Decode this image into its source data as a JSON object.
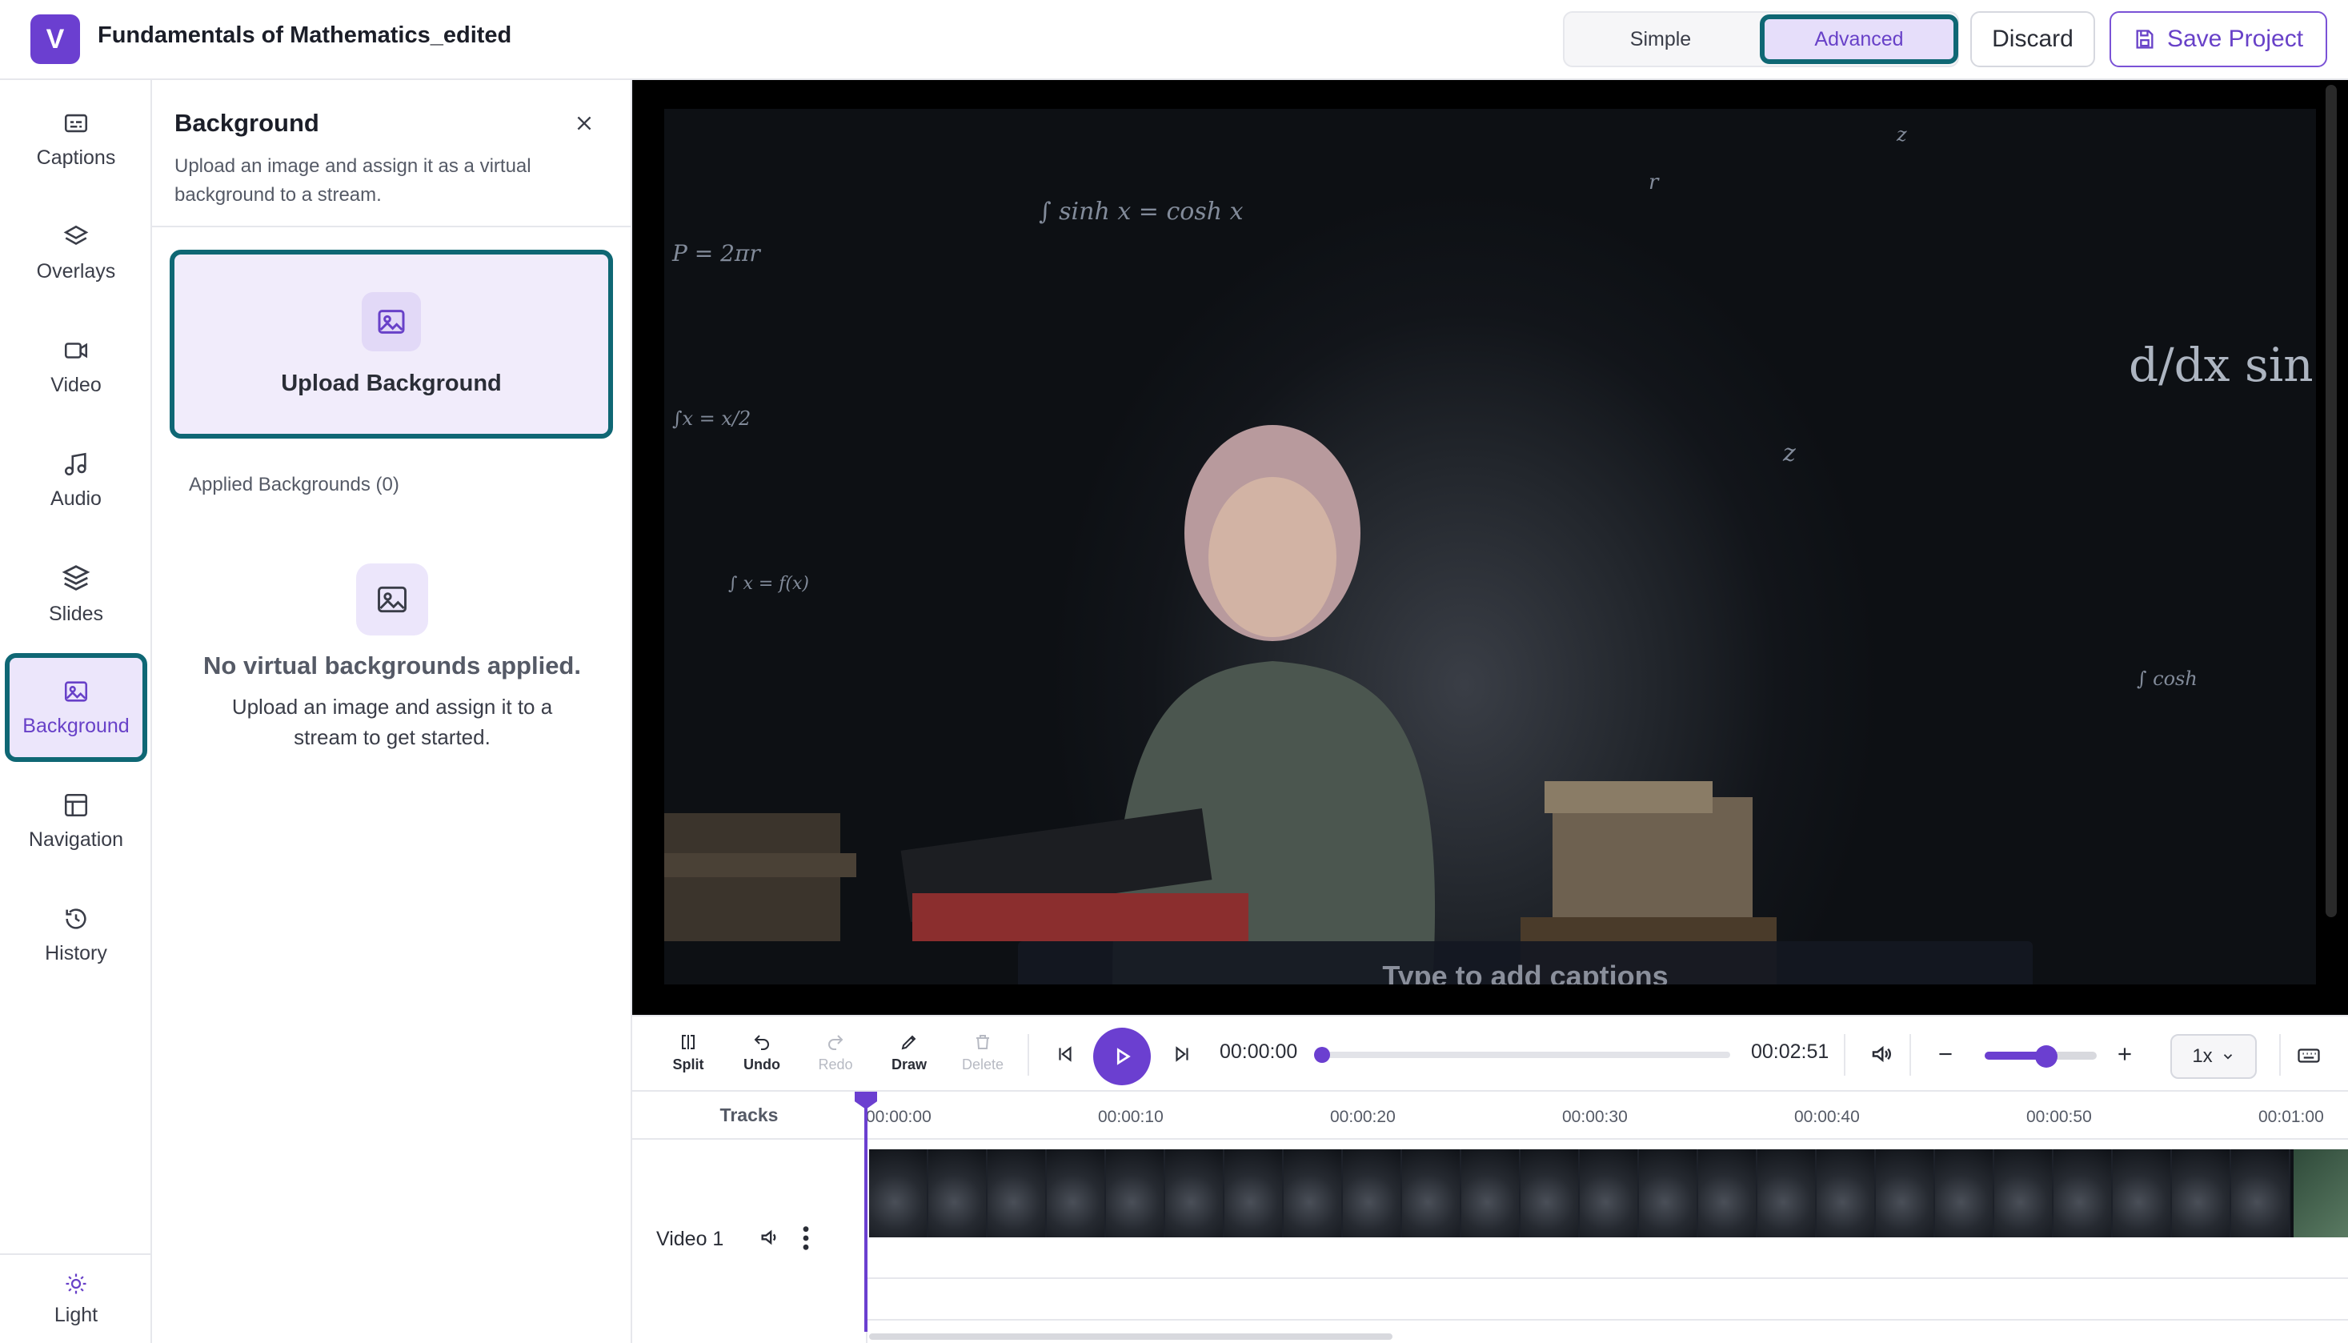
{
  "header": {
    "logo_letter": "V",
    "project_title": "Fundamentals of Mathematics_edited",
    "mode_simple": "Simple",
    "mode_advanced": "Advanced",
    "active_mode": "Advanced",
    "discard_label": "Discard",
    "save_label": "Save Project"
  },
  "sidebar": {
    "items": [
      {
        "label": "Captions",
        "icon": "captions-icon"
      },
      {
        "label": "Overlays",
        "icon": "layers-icon"
      },
      {
        "label": "Video",
        "icon": "video-camera-icon"
      },
      {
        "label": "Audio",
        "icon": "music-note-icon"
      },
      {
        "label": "Slides",
        "icon": "slides-stack-icon"
      },
      {
        "label": "Background",
        "icon": "image-icon"
      },
      {
        "label": "Navigation",
        "icon": "layout-icon"
      },
      {
        "label": "History",
        "icon": "history-icon"
      }
    ],
    "active": "Background",
    "theme_label": "Light"
  },
  "panel": {
    "title": "Background",
    "description": "Upload an image and assign it as a virtual background to a stream.",
    "upload_label": "Upload Background",
    "applied_label": "Applied Backgrounds (0)",
    "empty_title": "No virtual backgrounds applied.",
    "empty_desc": "Upload an image and assign it to a stream to get started."
  },
  "player": {
    "caption_placeholder": "Type to add captions",
    "current_time": "00:00:00",
    "duration": "00:02:51",
    "progress_fraction": 0,
    "speed": "1x",
    "zoom_fraction": 0.55
  },
  "toolbar": {
    "split": "Split",
    "undo": "Undo",
    "redo": "Redo",
    "draw": "Draw",
    "delete": "Delete"
  },
  "timeline": {
    "tracks_header": "Tracks",
    "ticks": [
      "00:00:00",
      "00:00:10",
      "00:00:20",
      "00:00:30",
      "00:00:40",
      "00:00:50",
      "00:01:00"
    ],
    "track_name": "Video 1"
  },
  "colors": {
    "accent": "#6b3fd0",
    "highlight_outline": "#0f6774"
  }
}
